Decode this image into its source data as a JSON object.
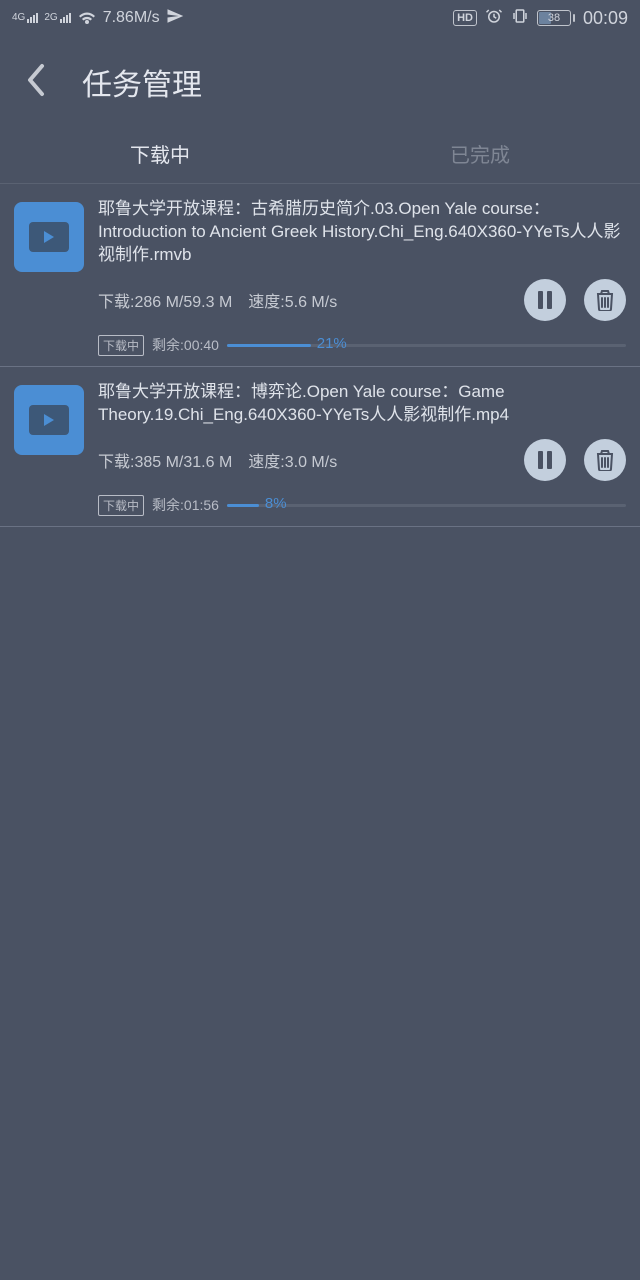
{
  "status": {
    "net1_label": "4G",
    "net2_label": "2G",
    "speed": "7.86M/s",
    "hd": "HD",
    "battery_pct": 38,
    "battery_text": "38",
    "time": "00:09"
  },
  "header": {
    "title": "任务管理"
  },
  "tabs": {
    "downloading": "下载中",
    "completed": "已完成"
  },
  "labels": {
    "download_prefix": "下载:",
    "speed_prefix": "速度:",
    "status_badge": "下载中",
    "remaining_prefix": "剩余:"
  },
  "items": [
    {
      "filename": "耶鲁大学开放课程：古希腊历史简介.03.Open Yale course：Introduction to Ancient Greek History.Chi_Eng.640X360-YYeTs人人影视制作.rmvb",
      "downloaded": "286 M/59.3 M",
      "speed": "5.6 M/s",
      "remaining": "00:40",
      "percent": 21,
      "percent_text": "21%"
    },
    {
      "filename": "耶鲁大学开放课程：博弈论.Open Yale course：Game Theory.19.Chi_Eng.640X360-YYeTs人人影视制作.mp4",
      "downloaded": "385 M/31.6 M",
      "speed": "3.0 M/s",
      "remaining": "01:56",
      "percent": 8,
      "percent_text": "8%"
    }
  ]
}
